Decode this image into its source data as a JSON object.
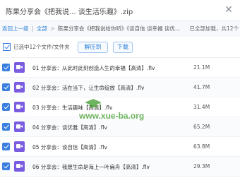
{
  "window": {
    "title": "陈果分享会《把我说... 谈生活乐趣》.zip",
    "close_icon": "close-icon"
  },
  "breadcrumb": {
    "back_label": "返回上一级",
    "separator": "|",
    "all_label": "全部",
    "arrow": ">",
    "path": "陈果分享会《把我说给你听》《谈自信 谈幸福 谈优...",
    "status": "已全部加载，共12个"
  },
  "toolbar": {
    "selected_label": "已选中12个文件/文件夹",
    "extract_label": "解压到",
    "download_label": "下载"
  },
  "files": [
    {
      "name": "01 分享会：从此时此刻创造人生的幸福【高清】.flv",
      "size": "21.1M"
    },
    {
      "name": "02 分享会：活在当下，让生命绽放【高清】.flv",
      "size": "41.7M"
    },
    {
      "name": "03 分享会：生活趣味【高清】.flv",
      "size": "31.4M"
    },
    {
      "name": "04 分享会：谈优雅【高清】.flv",
      "size": "65.2M"
    },
    {
      "name": "05 分享会：谈自信【高清】.flv",
      "size": "63.8M"
    },
    {
      "name": "06 分享会：我愿生命是海上一叶扁舟【高清】.flv",
      "size": "29.3M"
    }
  ],
  "watermark": {
    "text": "www.xue-ba.org",
    "color": "#3f9d2a"
  },
  "colors": {
    "accent": "#2a7fd6",
    "checkbox": "#3a7fe0",
    "file_icon": "#7a5ce0"
  }
}
